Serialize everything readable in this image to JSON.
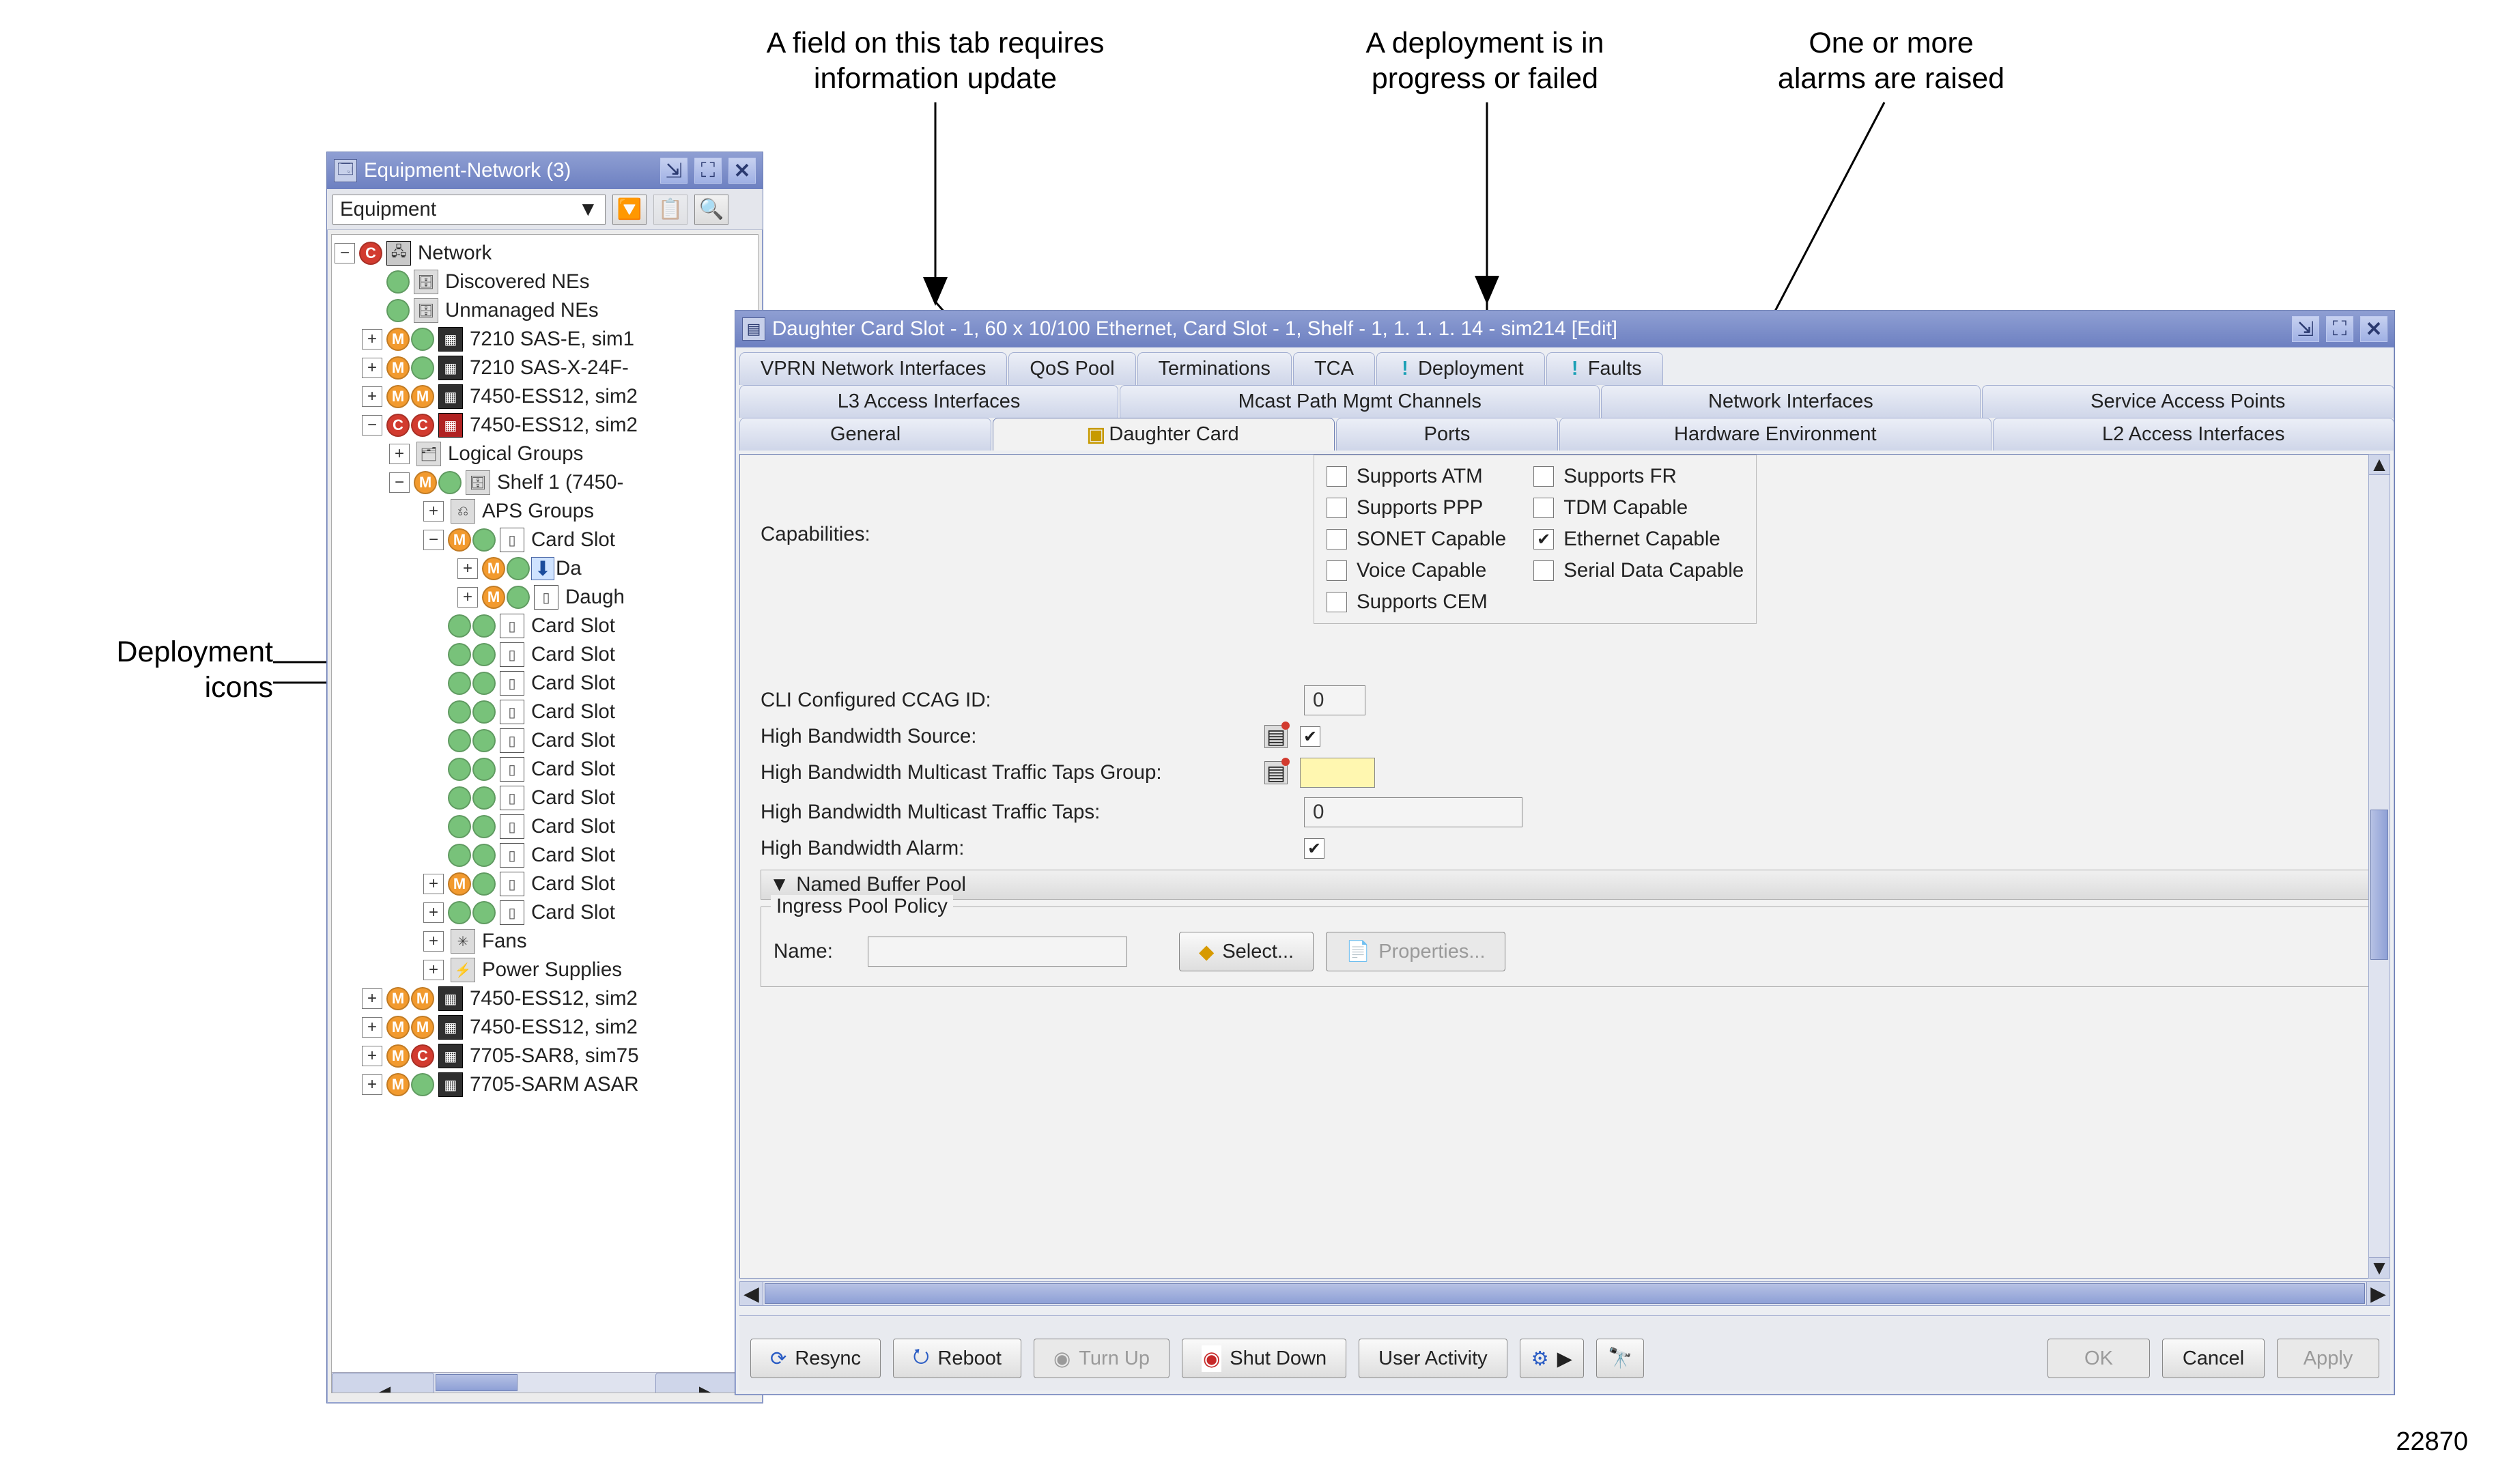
{
  "figure_number": "22870",
  "callouts": {
    "deploy_icons": "Deployment\nicons",
    "tab_info": "A field on this tab requires\ninformation update",
    "deploy_status": "A deployment is in\nprogress or failed",
    "alarms": "One or more\nalarms are raised"
  },
  "nav_win": {
    "title": "Equipment-Network (3)",
    "dropdown": "Equipment",
    "tree": {
      "root": "Network",
      "discovered": "Discovered NEs",
      "unmanaged": "Unmanaged NEs",
      "ne1": "7210 SAS-E, sim1",
      "ne2": "7210 SAS-X-24F-",
      "ne3": "7450-ESS12, sim2",
      "ne4": "7450-ESS12, sim2",
      "logical": "Logical Groups",
      "shelf": "Shelf 1 (7450-",
      "aps": "APS Groups",
      "cardslot": "Card Slot",
      "da_sel": "Da",
      "daugh": "Daugh",
      "fans": "Fans",
      "power": "Power Supplies",
      "ne5": "7450-ESS12, sim2",
      "ne6": "7450-ESS12, sim2",
      "ne7": "7705-SAR8, sim75",
      "ne8": "7705-SARM ASAR"
    }
  },
  "detail_win": {
    "title": "Daughter Card Slot - 1, 60 x 10/100 Ethernet, Card Slot - 1, Shelf - 1,  1. 1. 1. 14 - sim214 [Edit]",
    "tabs_row1": {
      "vprn": "VPRN Network Interfaces",
      "qos": "QoS Pool",
      "term": "Terminations",
      "tca": "TCA",
      "deploy": "Deployment",
      "faults": "Faults"
    },
    "tabs_row2": {
      "l3": "L3 Access Interfaces",
      "mcast": "Mcast Path Mgmt Channels",
      "neti": "Network Interfaces",
      "sap": "Service Access Points"
    },
    "tabs_row3": {
      "general": "General",
      "daughter": "Daughter Card",
      "ports": "Ports",
      "hw": "Hardware Environment",
      "l2": "L2 Access Interfaces"
    },
    "capabilities": {
      "label": "Capabilities:",
      "atm": "Supports ATM",
      "ppp": "Supports PPP",
      "sonet": "SONET Capable",
      "voice": "Voice Capable",
      "cem": "Supports CEM",
      "fr": "Supports FR",
      "tdm": "TDM Capable",
      "eth": "Ethernet Capable",
      "serial": "Serial Data Capable"
    },
    "fields": {
      "ccag_lbl": "CLI Configured CCAG ID:",
      "ccag_val": "0",
      "hbs_lbl": "High Bandwidth Source:",
      "hbmttg_lbl": "High Bandwidth Multicast Traffic Taps Group:",
      "hbmtt_lbl": "High Bandwidth Multicast Traffic Taps:",
      "hbmtt_val": "0",
      "hba_lbl": "High Bandwidth Alarm:"
    },
    "section": "Named Buffer Pool",
    "fieldset": {
      "legend": "Ingress Pool Policy",
      "name_lbl": "Name:",
      "select_btn": "Select...",
      "props_btn": "Properties..."
    },
    "footer": {
      "resync": "Resync",
      "reboot": "Reboot",
      "turnup": "Turn Up",
      "shutdown": "Shut Down",
      "useract": "User Activity",
      "ok": "OK",
      "cancel": "Cancel",
      "apply": "Apply"
    }
  }
}
